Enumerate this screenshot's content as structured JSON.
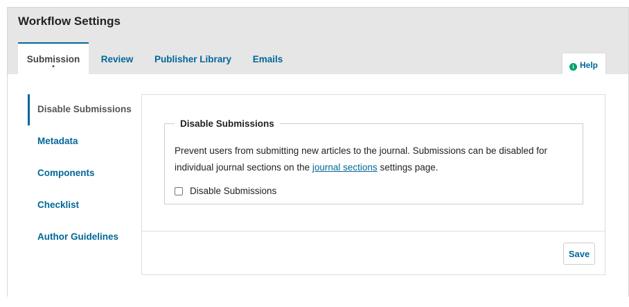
{
  "page": {
    "title": "Workflow Settings"
  },
  "tabs": [
    {
      "label": "Submission",
      "active": true
    },
    {
      "label": "Review"
    },
    {
      "label": "Publisher Library"
    },
    {
      "label": "Emails"
    }
  ],
  "help": {
    "label": "Help",
    "icon": "info-icon"
  },
  "side_nav": [
    {
      "label": "Disable Submissions",
      "active": true
    },
    {
      "label": "Metadata"
    },
    {
      "label": "Components"
    },
    {
      "label": "Checklist"
    },
    {
      "label": "Author Guidelines"
    }
  ],
  "section": {
    "legend": "Disable Submissions",
    "desc_part1": "Prevent users from submitting new articles to the journal. Submissions can be disabled for individual journal sections on the ",
    "link_text": "journal sections",
    "desc_part2": " settings page.",
    "checkbox_label": "Disable Submissions",
    "checkbox_checked": false
  },
  "footer": {
    "save_label": "Save"
  },
  "colors": {
    "accent": "#006798",
    "help_icon": "#00a36c"
  }
}
